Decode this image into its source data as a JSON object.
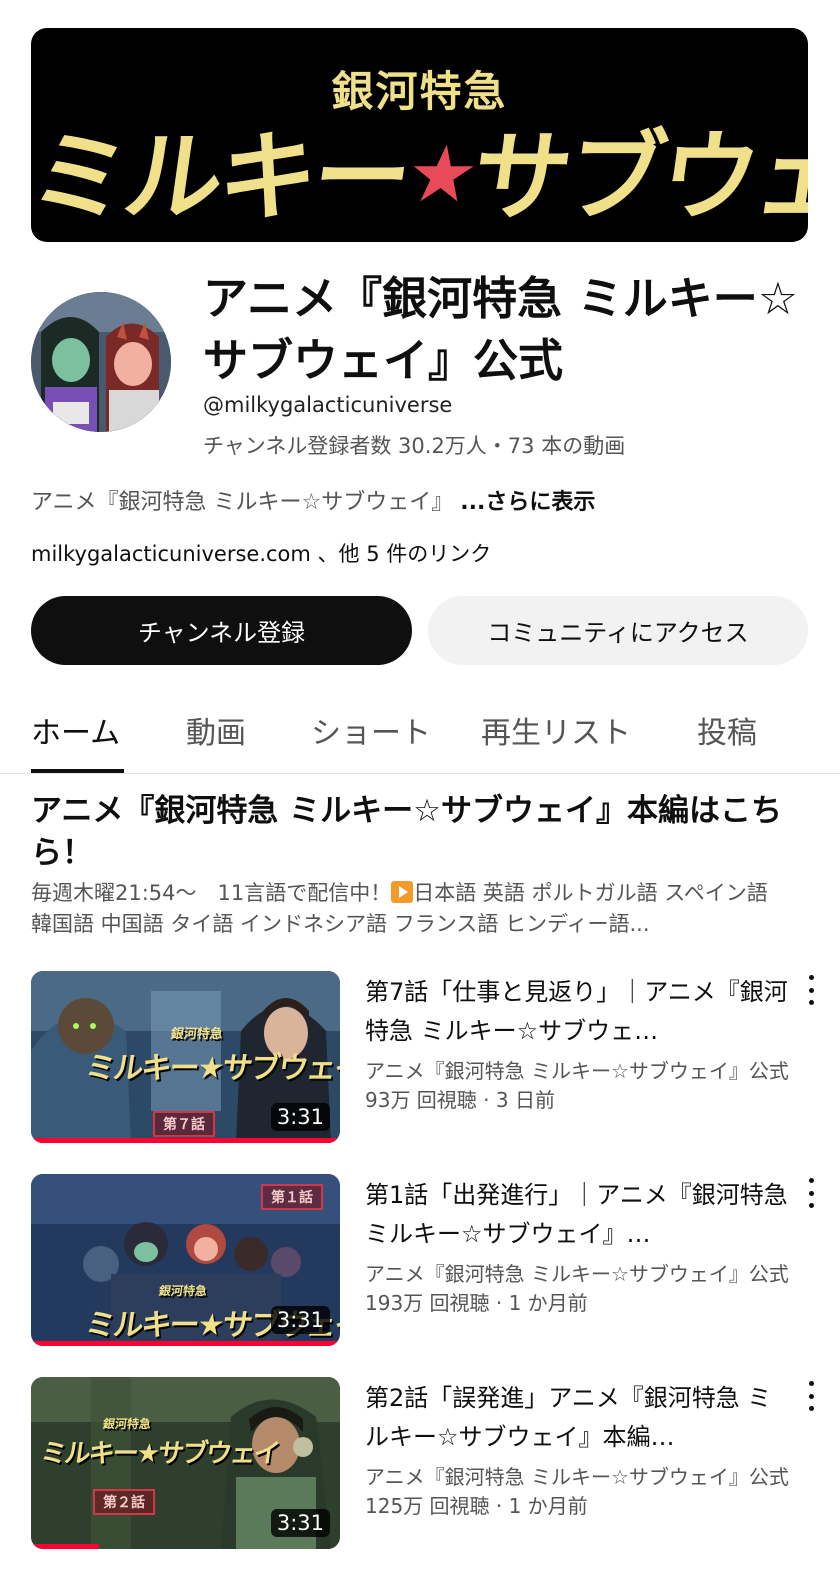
{
  "banner": {
    "subtitle": "銀河特急",
    "title_left": "ミルキー",
    "title_star": "★",
    "title_right": "サブウェイ"
  },
  "channel": {
    "name": "アニメ『銀河特急 ミルキー☆サブウェイ』公式",
    "handle": "@milkygalacticuniverse",
    "stats": "チャンネル登録者数 30.2万人・73 本の動画",
    "description": "アニメ『銀河特急 ミルキー☆サブウェイ』 ",
    "description_more": "...さらに表示",
    "links": "milkygalacticuniverse.com 、他 5 件のリンク"
  },
  "buttons": {
    "subscribe": "チャンネル登録",
    "community": "コミュニティにアクセス"
  },
  "tabs": [
    {
      "label": "ホーム",
      "active": true
    },
    {
      "label": "動画",
      "active": false
    },
    {
      "label": "ショート",
      "active": false
    },
    {
      "label": "再生リスト",
      "active": false
    },
    {
      "label": "投稿",
      "active": false
    }
  ],
  "section": {
    "title": "アニメ『銀河特急 ミルキー☆サブウェイ』本編はこちら！",
    "desc_prefix": "毎週木曜21:54～　11言語で配信中！",
    "desc_suffix": "日本語 英語 ポルトガル語 スペイン語 韓国語 中国語 タイ語 インドネシア語 フランス語 ヒンディー語..."
  },
  "videos": [
    {
      "title": "第7話「仕事と見返り」｜アニメ『銀河特急 ミルキー☆サブウェ…",
      "channel": "アニメ『銀河特急 ミルキー☆サブウェイ』公式",
      "meta": "93万 回視聴 · 3 日前",
      "duration": "3:31",
      "badge": "第７話",
      "thumb_logo_sub": "銀河特急",
      "thumb_logo": "ミルキー★サブウェイ",
      "progress": 1.0
    },
    {
      "title": "第1話「出発進行」｜アニメ『銀河特急 ミルキー☆サブウェイ』…",
      "channel": "アニメ『銀河特急 ミルキー☆サブウェイ』公式",
      "meta": "193万 回視聴 · 1 か月前",
      "duration": "3:31",
      "badge": "第１話",
      "thumb_logo_sub": "銀河特急",
      "thumb_logo": "ミルキー★サブウェイ",
      "progress": 1.0
    },
    {
      "title": "第2話「誤発進」アニメ『銀河特急 ミルキー☆サブウェイ』本編…",
      "channel": "アニメ『銀河特急 ミルキー☆サブウェイ』公式",
      "meta": "125万 回視聴 · 1 か月前",
      "duration": "3:31",
      "badge": "第２話",
      "thumb_logo_sub": "銀河特急",
      "thumb_logo": "ミルキー★サブウェイ",
      "progress": 0.22
    }
  ],
  "colors": {
    "banner_bg": "#000000",
    "banner_text": "#f0e08a",
    "banner_star": "#e84a5a",
    "subscribe_bg": "#0f0f0f",
    "progress": "#ff0033"
  }
}
